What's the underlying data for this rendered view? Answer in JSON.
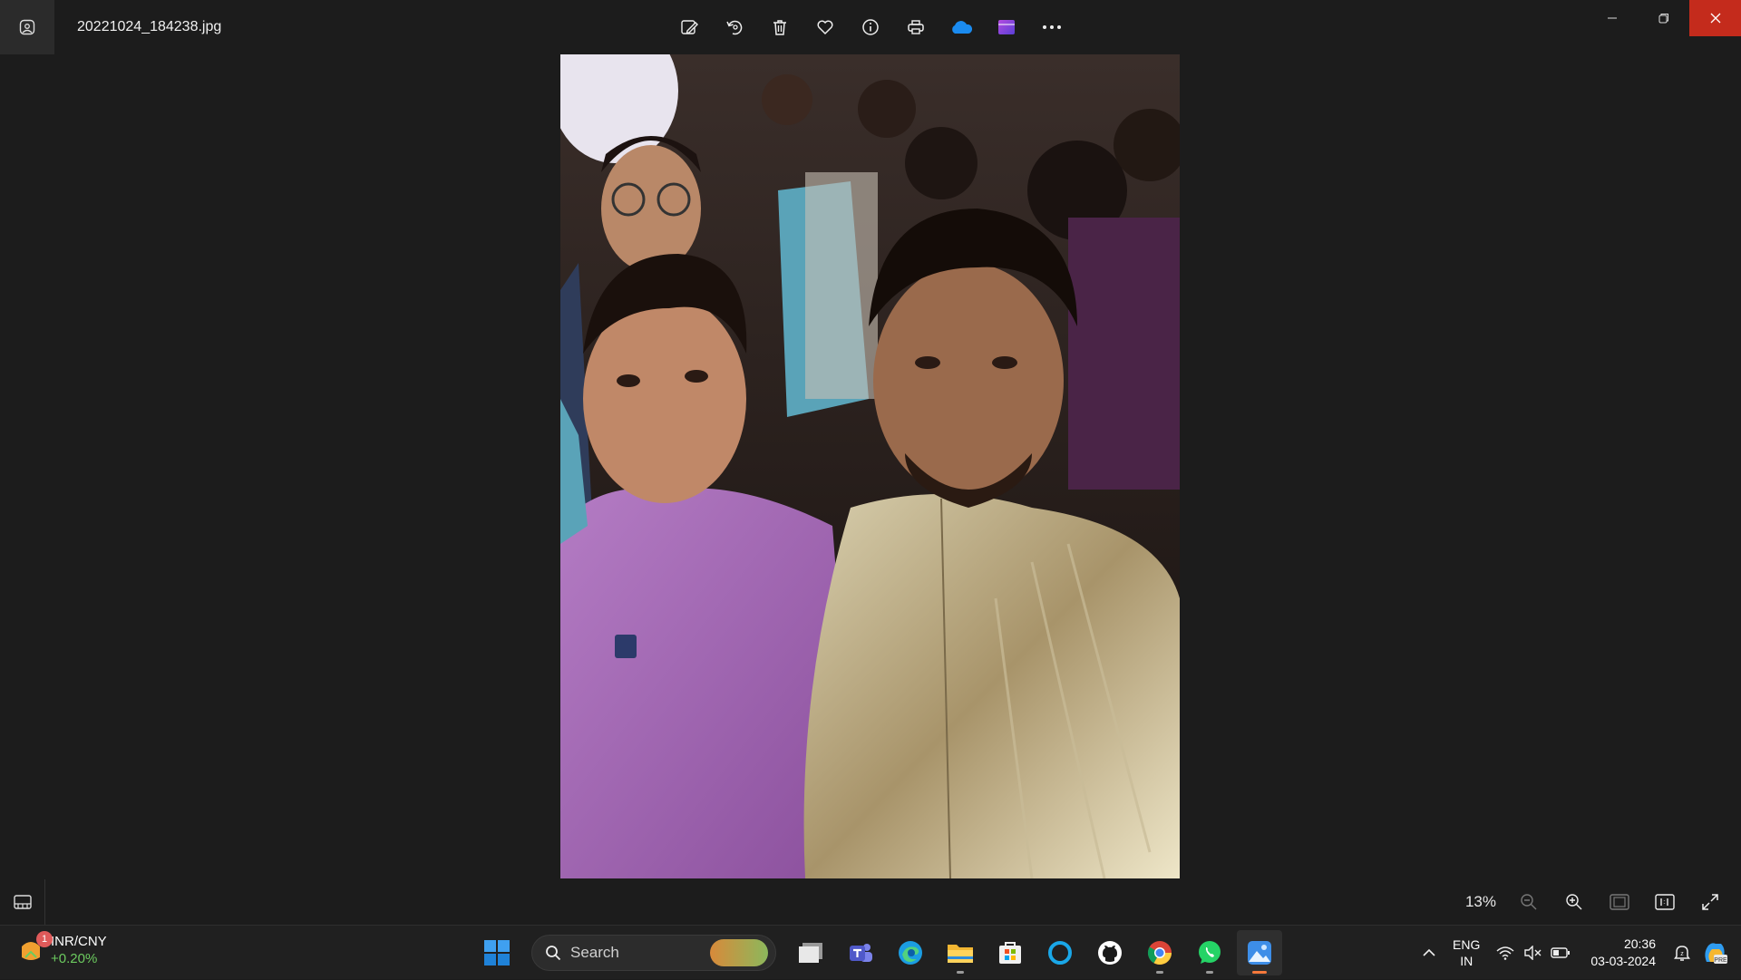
{
  "window": {
    "filename": "20221024_184238.jpg",
    "toolbar": [
      {
        "name": "edit-image-icon"
      },
      {
        "name": "rotate-icon"
      },
      {
        "name": "delete-icon"
      },
      {
        "name": "favorite-icon"
      },
      {
        "name": "file-info-icon"
      },
      {
        "name": "print-icon"
      },
      {
        "name": "onedrive-icon"
      },
      {
        "name": "clipchamp-icon"
      },
      {
        "name": "more-options-icon"
      }
    ],
    "controls": [
      "minimize-icon",
      "restore-icon",
      "close-icon"
    ]
  },
  "viewer": {
    "photo_description_icon": "photo"
  },
  "bottombar": {
    "zoom_level": "13%"
  },
  "taskbar": {
    "widget": {
      "badge": "1",
      "title": "INR/CNY",
      "change": "+0.20%"
    },
    "search_placeholder": "Search",
    "apps": [
      "start-icon",
      "task-view-icon",
      "teams-icon",
      "edge-icon",
      "file-explorer-icon",
      "microsoft-store-icon",
      "cortana-icon",
      "github-icon",
      "chrome-icon",
      "whatsapp-icon",
      "photos-icon"
    ],
    "tray": {
      "lang_line1": "ENG",
      "lang_line2": "IN",
      "time": "20:36",
      "date": "03-03-2024"
    }
  },
  "colors": {
    "close": "#c42b1c",
    "accent": "#f6793b",
    "positive": "#6ccb5f"
  }
}
